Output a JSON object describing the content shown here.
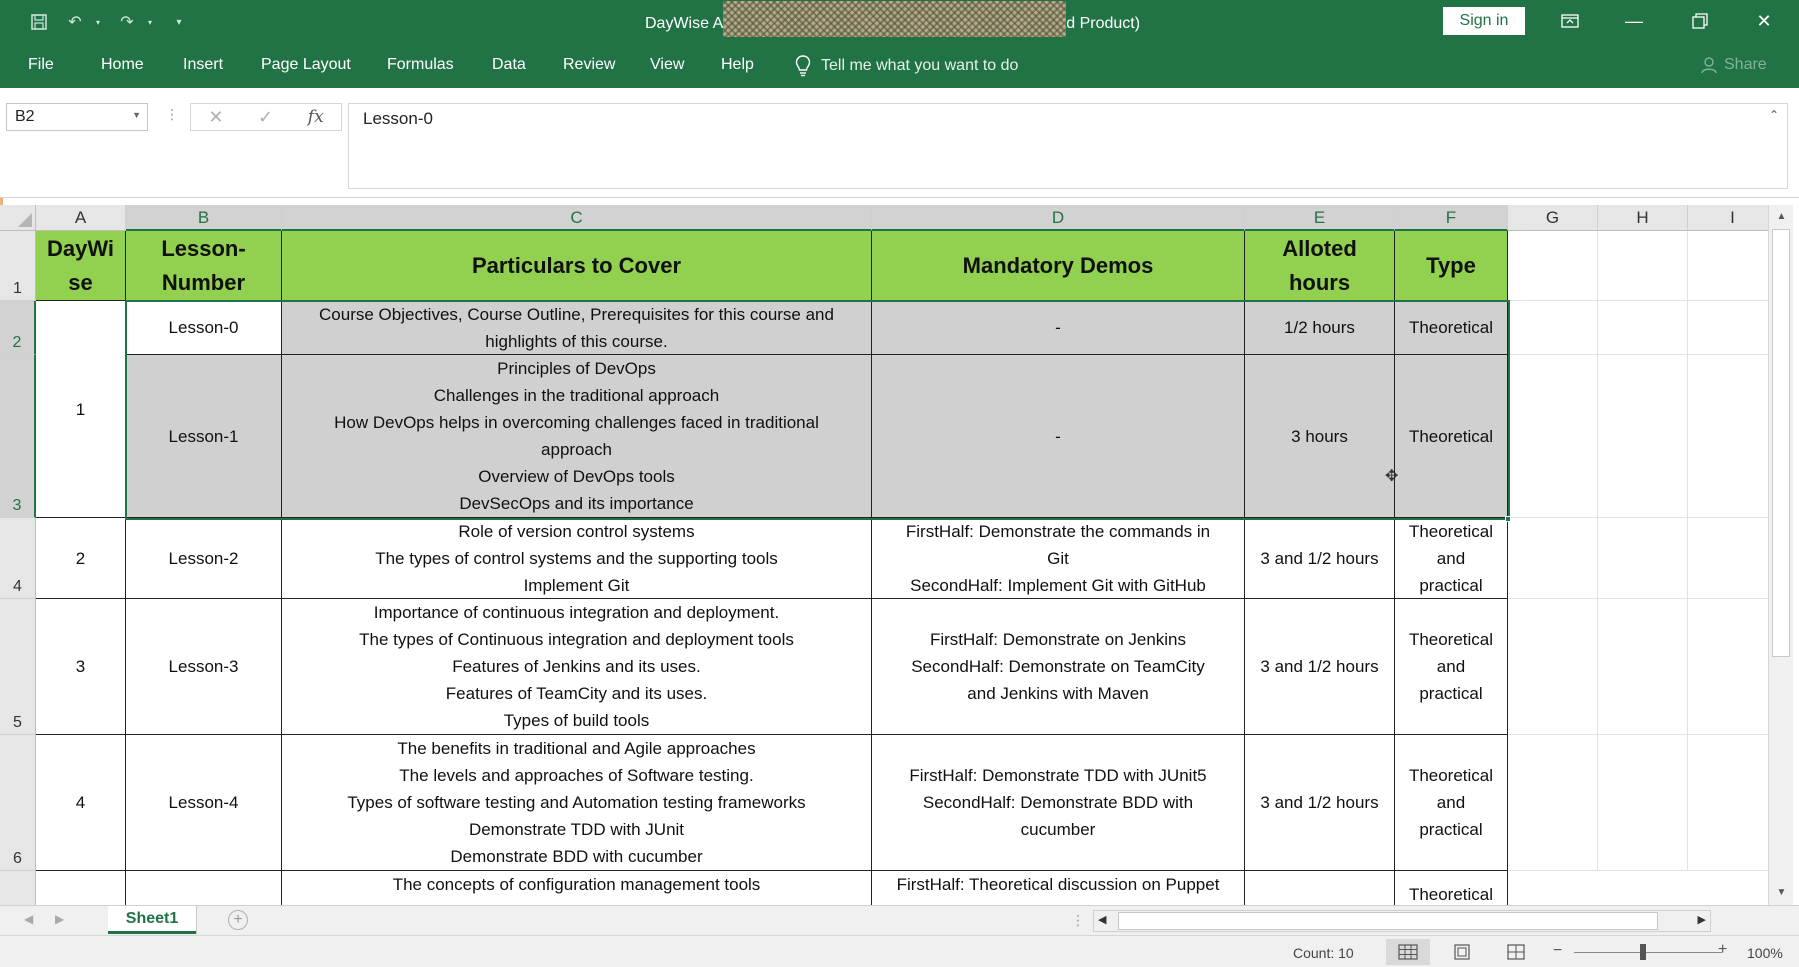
{
  "window": {
    "title_left": "DayWise A",
    "title_right": "d Product)",
    "sign_in": "Sign in"
  },
  "ribbon": {
    "tabs": [
      "File",
      "Home",
      "Insert",
      "Page Layout",
      "Formulas",
      "Data",
      "Review",
      "View",
      "Help"
    ],
    "tell_me": "Tell me what you want to do",
    "share": "Share"
  },
  "formula_bar": {
    "name_box": "B2",
    "fx": "fx",
    "value": "Lesson-0"
  },
  "columns": [
    "A",
    "B",
    "C",
    "D",
    "E",
    "F",
    "G",
    "H",
    "I"
  ],
  "rows": [
    "1",
    "2",
    "3",
    "4",
    "5",
    "6"
  ],
  "table": {
    "header": {
      "A": "DayWi\nse",
      "B": "Lesson-\nNumber",
      "C": "Particulars to Cover",
      "D": "Mandatory Demos",
      "E": "Alloted\nhours",
      "F": "Type"
    },
    "day1": "1",
    "lessons": [
      {
        "B": "Lesson-0",
        "C": "Course Objectives, Course Outline, Prerequisites for this course and\nhighlights of this course.",
        "D": "-",
        "E": "1/2 hours",
        "F": "Theoretical"
      },
      {
        "B": "Lesson-1",
        "C": "Principles of DevOps\nChallenges in the traditional approach\nHow DevOps helps in overcoming challenges faced in traditional\napproach\nOverview of DevOps tools\nDevSecOps and its importance",
        "D": "-",
        "E": "3 hours",
        "F": "Theoretical"
      },
      {
        "A": "2",
        "B": "Lesson-2",
        "C": "Role of version control systems\nThe types of control systems and the supporting tools\nImplement Git",
        "D": "FirstHalf: Demonstrate the commands in\nGit\nSecondHalf: Implement Git with GitHub",
        "E": "3 and 1/2 hours",
        "F": "Theoretical\nand\npractical"
      },
      {
        "A": "3",
        "B": "Lesson-3",
        "C": "Importance of continuous integration and deployment.\nThe types of Continuous integration and deployment tools\nFeatures of Jenkins and its uses.\nFeatures of TeamCity and its uses.\nTypes of build tools",
        "D": "FirstHalf: Demonstrate on Jenkins\nSecondHalf: Demonstrate on TeamCity\nand Jenkins with Maven",
        "E": "3 and 1/2 hours",
        "F": "Theoretical\nand\npractical"
      },
      {
        "A": "4",
        "B": "Lesson-4",
        "C": "The benefits in traditional and Agile approaches\nThe levels and approaches of Software testing.\nTypes of software testing and Automation testing frameworks\nDemonstrate TDD with JUnit\nDemonstrate BDD with cucumber",
        "D": "FirstHalf: Demonstrate TDD with JUnit5\nSecondHalf: Demonstrate BDD with\ncucumber",
        "E": "3 and 1/2 hours",
        "F": "Theoretical\nand\npractical"
      }
    ],
    "partial_row": {
      "C": "The concepts of configuration management tools",
      "D": "FirstHalf: Theoretical discussion on Puppet",
      "F": "Theoretical"
    }
  },
  "sheets": {
    "active": "Sheet1"
  },
  "status": {
    "count": "Count: 10",
    "zoom": "100%"
  },
  "colors": {
    "brand": "#217346",
    "header_fill": "#92d050",
    "selection_fill": "#d0d0d0"
  }
}
